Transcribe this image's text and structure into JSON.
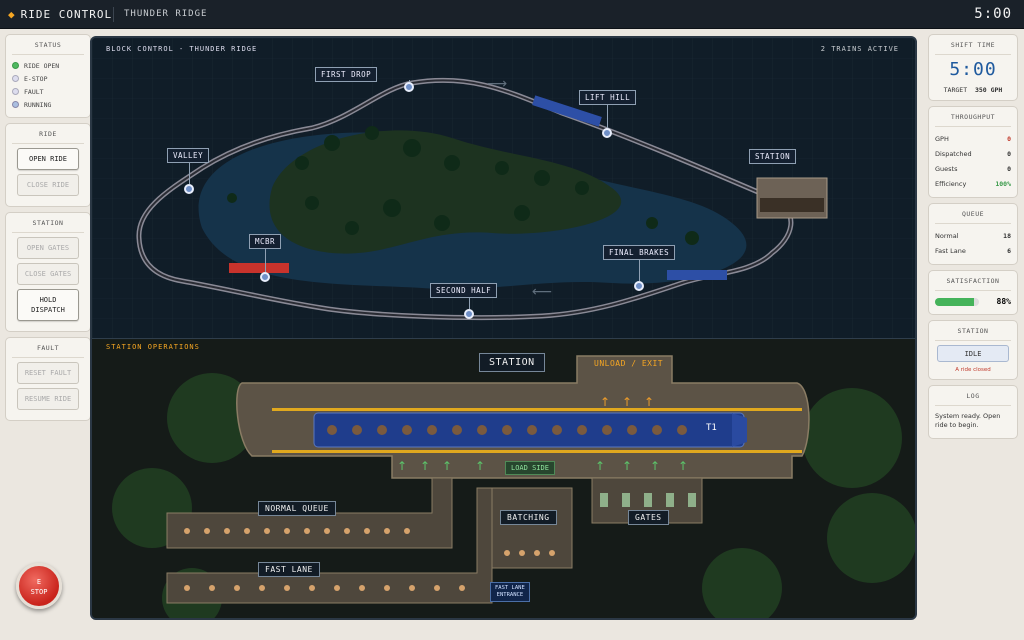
{
  "topbar": {
    "app_title": "RIDE CONTROL",
    "ride_name": "THUNDER RIDGE",
    "clock": "5:00"
  },
  "left": {
    "status": {
      "title": "STATUS",
      "items": [
        {
          "label": "RIDE OPEN",
          "color": "#4fb860"
        },
        {
          "label": "E-STOP",
          "color": "#dde"
        },
        {
          "label": "FAULT",
          "color": "#dde"
        },
        {
          "label": "RUNNING",
          "color": "#aabfe0"
        }
      ]
    },
    "ride": {
      "title": "RIDE",
      "open": "OPEN RIDE",
      "close": "CLOSE RIDE"
    },
    "station": {
      "title": "STATION",
      "open_gates": "OPEN GATES",
      "close_gates": "CLOSE GATES",
      "hold_dispatch": "HOLD\nDISPATCH"
    },
    "fault": {
      "title": "FAULT",
      "reset": "RESET FAULT",
      "resume": "RESUME RIDE"
    },
    "estop": {
      "line1": "E",
      "line2": "STOP"
    }
  },
  "right": {
    "shift": {
      "title": "SHIFT TIME",
      "time": "5:00",
      "target_label": "TARGET",
      "target_value": "350 GPH"
    },
    "throughput": {
      "title": "THROUGHPUT",
      "rows": [
        {
          "label": "GPH",
          "value": "0"
        },
        {
          "label": "Dispatched",
          "value": "0"
        },
        {
          "label": "Guests",
          "value": "0"
        },
        {
          "label": "Efficiency",
          "value": "100%"
        }
      ]
    },
    "queue": {
      "title": "QUEUE",
      "rows": [
        {
          "label": "Normal",
          "value": "18"
        },
        {
          "label": "Fast Lane",
          "value": "6"
        }
      ]
    },
    "satisfaction": {
      "title": "SATISFACTION",
      "value": "88%",
      "fraction": 0.88
    },
    "station": {
      "title": "STATION",
      "state": "IDLE",
      "note": "A ride closed"
    },
    "log": {
      "title": "LOG",
      "text": "System ready. Open ride to begin."
    }
  },
  "main": {
    "block_title": "BLOCK CONTROL - THUNDER RIDGE",
    "trains_active": "2 TRAINS ACTIVE",
    "track_labels": {
      "first_drop": "FIRST DROP",
      "lift_hill": "LIFT HILL",
      "valley": "VALLEY",
      "station": "STATION",
      "mcbr": "MCBR",
      "final_brakes": "FINAL BRAKES",
      "second_half": "SECOND HALF"
    },
    "station_ops": "STATION OPERATIONS",
    "station_big": "STATION",
    "unload_exit": "UNLOAD / EXIT",
    "train_id": "T1",
    "load_side": "LOAD SIDE",
    "normal_queue": "NORMAL QUEUE",
    "batching": "BATCHING",
    "gates": "GATES",
    "fast_lane": "FAST LANE",
    "fast_lane_entrance_1": "FAST LANE",
    "fast_lane_entrance_2": "ENTRANCE"
  },
  "colors": {
    "accent": "#f5a623",
    "brand_blue": "#1f5a9e",
    "danger": "#c0392b",
    "ok": "#45b35a"
  }
}
